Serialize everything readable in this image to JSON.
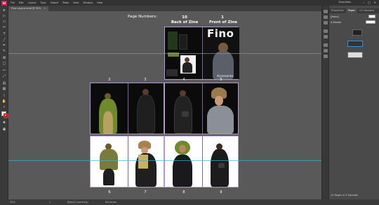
{
  "app": {
    "logo": "Id",
    "menu": [
      "File",
      "Edit",
      "Layout",
      "Type",
      "Object",
      "Table",
      "View",
      "Window",
      "Help"
    ],
    "workspace": "Essentials",
    "window_buttons": [
      "–",
      "□",
      "✕"
    ],
    "document_tab": "Fino Layout.indd @ 32%",
    "document_tab_close": "×"
  },
  "canvas": {
    "page_numbers_label": "Page Numbers:",
    "top_spread": {
      "left_number": "10",
      "left_caption": "Back of Zine",
      "right_number": "1",
      "right_caption": "Front of Zine",
      "cover_title": "Fino",
      "cover_subtitle": "Accessories"
    },
    "middle_numbers": [
      "2",
      "3",
      "4",
      "5"
    ],
    "bottom_numbers": [
      "6",
      "7",
      "8",
      "9"
    ]
  },
  "toolbar": {
    "tools": [
      "selection-icon",
      "direct-selection-icon",
      "page-tool-icon",
      "gap-tool-icon",
      "type-icon",
      "line-icon",
      "pen-icon",
      "pencil-icon",
      "rectangle-frame-icon",
      "rectangle-icon",
      "scissors-icon",
      "free-transform-icon",
      "gradient-icon",
      "note-icon",
      "eyedropper-icon",
      "hand-icon",
      "zoom-icon"
    ],
    "fill_color": "#ffffff",
    "stroke_color": "#e02020"
  },
  "panel": {
    "tabs": [
      "Properties",
      "Pages",
      "CC Libraries"
    ],
    "active_tab": "Pages",
    "none_label": "[None]",
    "master_label": "A-Master",
    "footer": "10 Pages in 6 Spreads"
  },
  "statusbar": {
    "zoom": "32%",
    "page": "1",
    "preflight": "[Basic] (working)",
    "errors": "No errors"
  },
  "colors": {
    "accent": "#3fb4c8",
    "spread_border": "#b497d1"
  }
}
